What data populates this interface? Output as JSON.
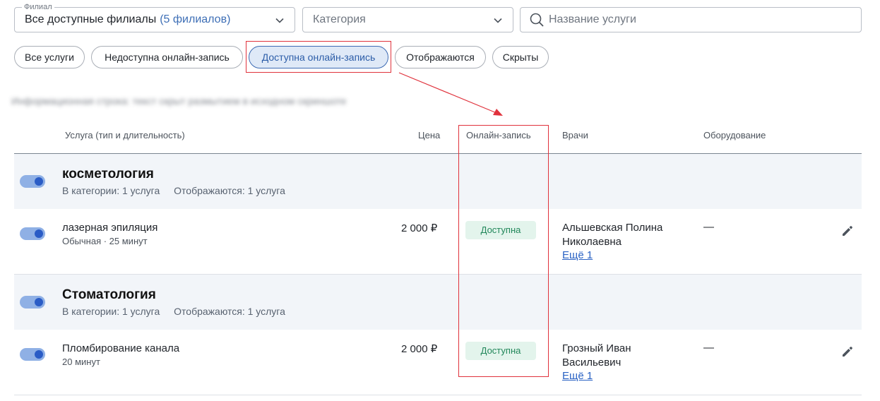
{
  "filters": {
    "branch": {
      "legend": "Филиал",
      "value": "Все доступные филиалы",
      "count": "(5 филиалов)"
    },
    "category": {
      "placeholder": "Категория"
    },
    "search": {
      "placeholder": "Название услуги",
      "value": ""
    }
  },
  "chips": [
    {
      "label": "Все услуги",
      "active": false
    },
    {
      "label": "Недоступна онлайн-запись",
      "active": false
    },
    {
      "label": "Доступна онлайн-запись",
      "active": true
    },
    {
      "label": "Отображаются",
      "active": false
    },
    {
      "label": "Скрыты",
      "active": false
    }
  ],
  "blurred_info": "Информационная строка: текст скрыт размытием в исходном скриншоте",
  "table": {
    "headers": {
      "service": "Услуга (тип и длительность)",
      "price": "Цена",
      "online": "Онлайн-запись",
      "doctors": "Врачи",
      "equipment": "Оборудование"
    },
    "categories": [
      {
        "title": "косметология",
        "in_category": "В категории: 1 услуга",
        "displayed": "Отображаются: 1 услуга",
        "service": {
          "name": "лазерная эпиляция",
          "sub": "Обычная · 25 минут",
          "price": "2 000 ₽",
          "online": "Доступна",
          "doctor": "Альшевская Полина Николаевна",
          "more": "Ещё 1",
          "equipment": "—"
        }
      },
      {
        "title": "Стоматология",
        "in_category": "В категории: 1 услуга",
        "displayed": "Отображаются: 1 услуга",
        "service": {
          "name": "Пломбирование канала",
          "sub": "20 минут",
          "price": "2 000 ₽",
          "online": "Доступна",
          "doctor": "Грозный Иван Васильевич",
          "more": "Ещё 1",
          "equipment": "—"
        }
      }
    ]
  },
  "colors": {
    "accent": "#2c5da8",
    "annotation": "#e0323c",
    "badge_bg": "#e3f4ec",
    "badge_text": "#22875a",
    "toggle_on": "#2a5cc6"
  },
  "icons": [
    "chevron-down-icon",
    "search-icon",
    "pencil-icon",
    "arrow-annotation"
  ]
}
